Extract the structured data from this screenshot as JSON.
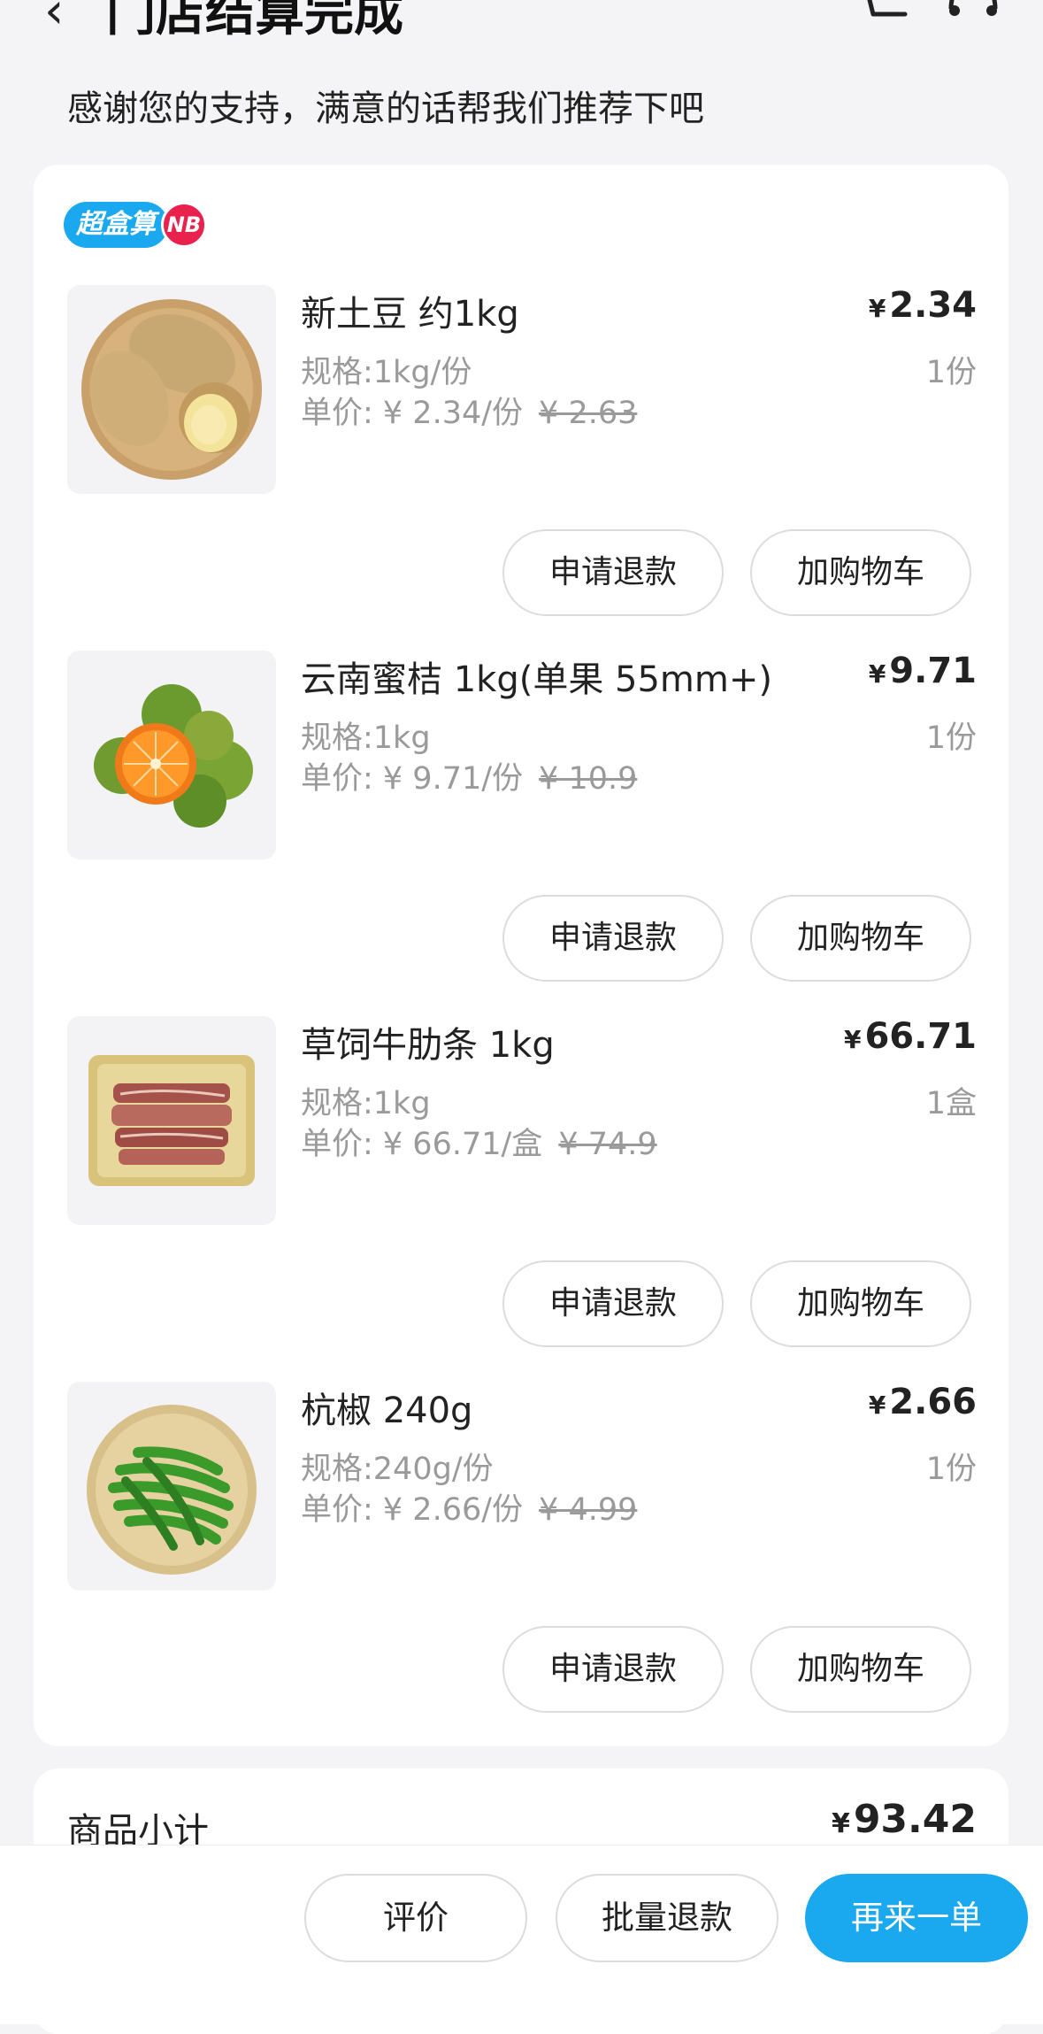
{
  "header": {
    "title": "门店结算完成",
    "subtitle": "感谢您的支持，满意的话帮我们推荐下吧"
  },
  "brand": {
    "name": "超盒算",
    "tag": "NB"
  },
  "currency": "¥",
  "items": [
    {
      "name": "新土豆 约1kg",
      "price": "2.34",
      "spec": "规格:1kg/份",
      "qty": "1份",
      "unit_price": "单价: ¥ 2.34/份",
      "original_price": "¥ 2.63",
      "refund_label": "申请退款",
      "cart_label": "加购物车",
      "image": "potato-image"
    },
    {
      "name": "云南蜜桔 1kg(单果 55mm+)",
      "price": "9.71",
      "spec": "规格:1kg",
      "qty": "1份",
      "unit_price": "单价: ¥ 9.71/份",
      "original_price": "¥ 10.9",
      "refund_label": "申请退款",
      "cart_label": "加购物车",
      "image": "tangerine-image"
    },
    {
      "name": "草饲牛肋条 1kg",
      "price": "66.71",
      "spec": "规格:1kg",
      "qty": "1盒",
      "unit_price": "单价: ¥ 66.71/盒",
      "original_price": "¥ 74.9",
      "refund_label": "申请退款",
      "cart_label": "加购物车",
      "image": "beef-rib-image"
    },
    {
      "name": "杭椒 240g",
      "price": "2.66",
      "spec": "规格:240g/份",
      "qty": "1份",
      "unit_price": "单价: ¥ 2.66/份",
      "original_price": "¥ 4.99",
      "refund_label": "申请退款",
      "cart_label": "加购物车",
      "image": "green-pepper-image"
    }
  ],
  "summary": {
    "subtotal_label": "商品小计",
    "subtotal_value": "93.42"
  },
  "bottom_bar": {
    "review_label": "评价",
    "batch_refund_label": "批量退款",
    "reorder_label": "再来一单"
  },
  "colors": {
    "accent": "#1aa8ee",
    "badge_red": "#e8224d",
    "muted_text": "#9a9a9a",
    "page_bg": "#f4f4f6"
  }
}
